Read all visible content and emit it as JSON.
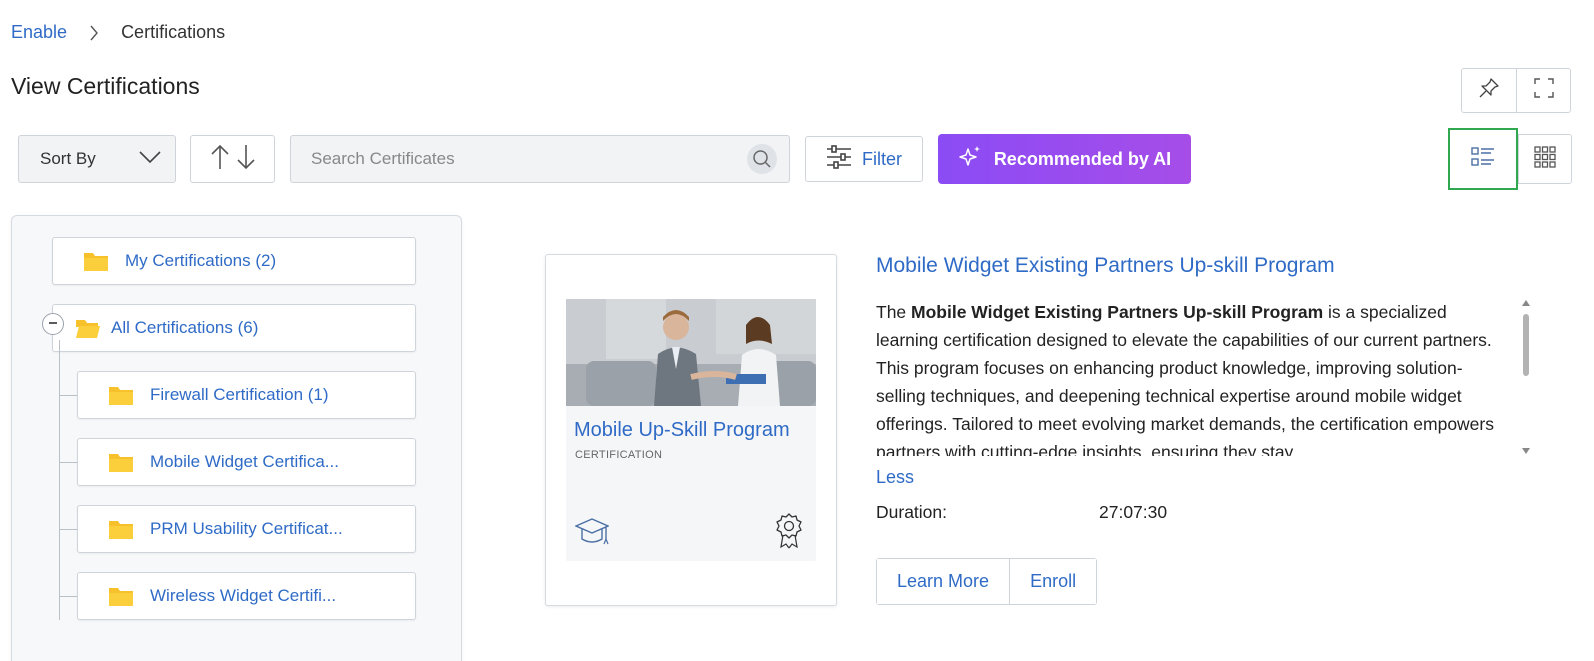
{
  "breadcrumb": {
    "root": "Enable",
    "current": "Certifications"
  },
  "page": {
    "title": "View Certifications"
  },
  "toolbar": {
    "sort_label": "Sort By",
    "search_placeholder": "Search Certificates",
    "filter_label": "Filter",
    "ai_label": "Recommended by AI",
    "active_view": "list"
  },
  "tree": {
    "my_certifications": "My Certifications (2)",
    "all_certifications": "All Certifications (6)",
    "children": [
      "Firewall Certification (1)",
      "Mobile Widget Certifica...",
      "PRM Usability Certificat...",
      "Wireless Widget Certifi..."
    ]
  },
  "card": {
    "title": "Mobile Up-Skill Program",
    "subtitle": "CERTIFICATION"
  },
  "detail": {
    "title": "Mobile Widget Existing Partners Up-skill Program",
    "desc_prefix": "The ",
    "desc_bold": "Mobile Widget Existing Partners Up-skill Program",
    "desc_rest": " is a specialized learning certification designed to elevate the capabilities of our current partners. This program focuses on enhancing product knowledge, improving solution-selling techniques, and deepening technical expertise around mobile widget offerings. Tailored to meet evolving market demands, the certification empowers partners with cutting-edge insights, ensuring they stay",
    "less_label": "Less",
    "duration_label": "Duration:",
    "duration_value": "27:07:30",
    "learn_more_label": "Learn More",
    "enroll_label": "Enroll"
  },
  "colors": {
    "link": "#2f6bc6",
    "ai_gradient_start": "#8b4cf5",
    "ai_gradient_end": "#a64de8",
    "active_view_outline": "#2fa84f",
    "folder": "#f6c12b"
  }
}
